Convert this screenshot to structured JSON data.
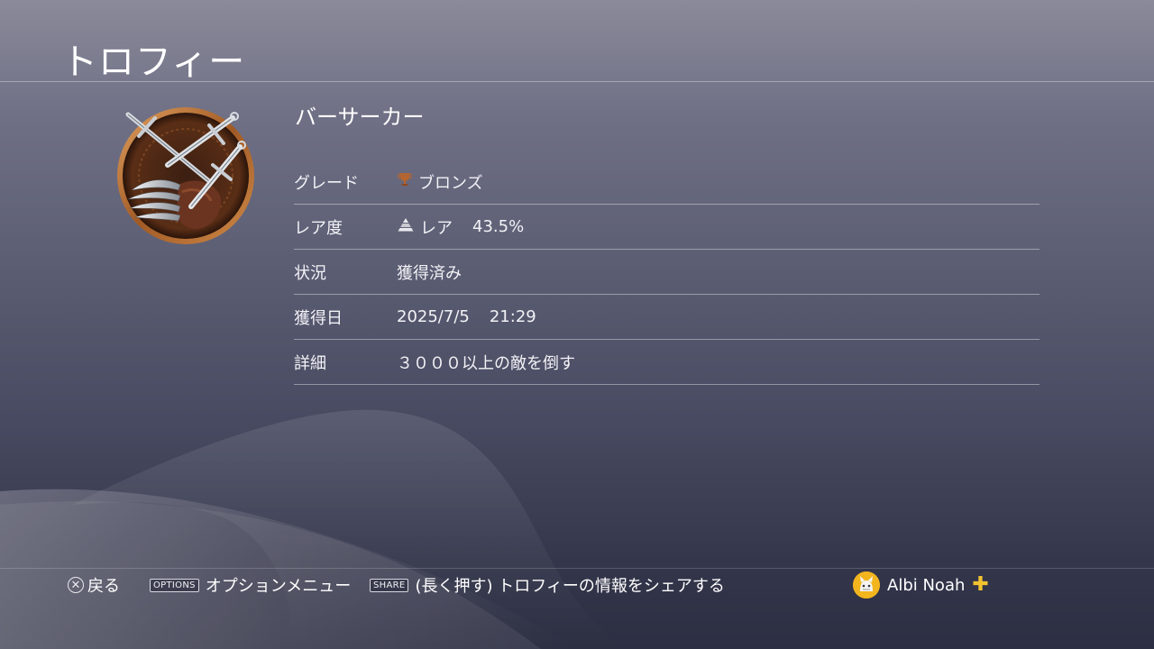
{
  "header": {
    "title": "トロフィー"
  },
  "trophy": {
    "name": "バーサーカー",
    "icon": "crossed-swords-and-claw-trophy-icon",
    "grade_icon": "bronze-trophy-icon",
    "rarity_icon": "rarity-pyramid-icon"
  },
  "details": {
    "grade": {
      "label": "グレード",
      "value": "ブロンズ"
    },
    "rarity": {
      "label": "レア度",
      "value": "レア",
      "percent": "43.5%"
    },
    "status": {
      "label": "状況",
      "value": "獲得済み"
    },
    "earned": {
      "label": "獲得日",
      "date": "2025/7/5",
      "time": "21:29"
    },
    "description": {
      "label": "詳細",
      "value": "３０００以上の敵を倒す"
    }
  },
  "footer": {
    "back": {
      "icon": "cross-button-icon",
      "label": "戻る"
    },
    "options": {
      "key": "OPTIONS",
      "label": "オプションメニュー"
    },
    "share": {
      "key": "SHARE",
      "label": "(長く押す) トロフィーの情報をシェアする"
    }
  },
  "user": {
    "name": "Albi Noah",
    "badge": "playstation-plus-icon"
  },
  "colors": {
    "bronze": "#b5652f",
    "plus_gold": "#f2c230"
  }
}
